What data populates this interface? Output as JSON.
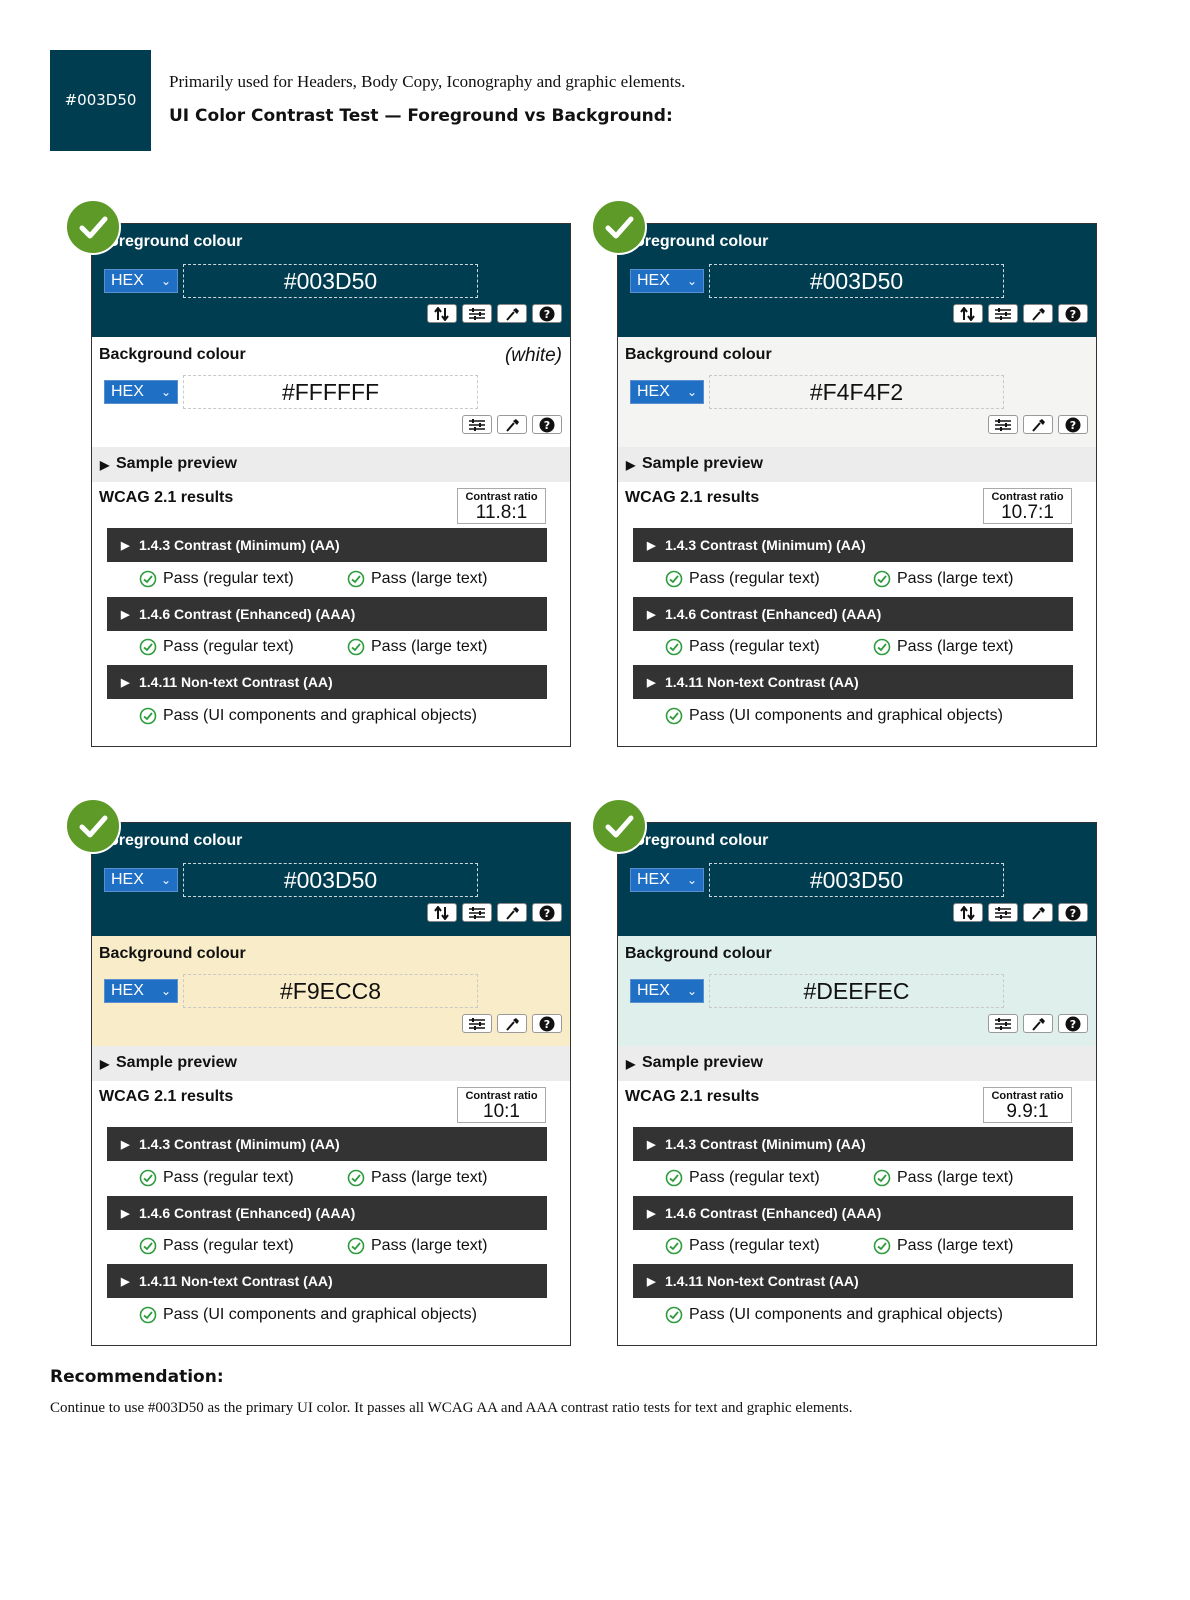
{
  "header": {
    "swatch_label": "#003D50",
    "swatch_color": "#003D50",
    "intro": "Primarily used for Headers, Body Copy, Iconography and graphic elements.",
    "subtitle": "UI Color Contrast Test — Foreground vs Background:"
  },
  "cards": [
    {
      "fg_title": "oreground colour",
      "fg_format": "HEX",
      "fg_hex": "#003D50",
      "bg_title": "Background colour",
      "bg_note": "(white)",
      "bg_format": "HEX",
      "bg_hex": "#FFFFFF",
      "bg_color": "#FFFFFF",
      "sample_label": "Sample preview",
      "results_title": "WCAG 2.1 results",
      "ratio_label": "Contrast ratio",
      "ratio_value": "11.8:1",
      "criteria": [
        {
          "label": "1.4.3 Contrast (Minimum) (AA)",
          "results": [
            "Pass (regular text)",
            "Pass (large text)"
          ]
        },
        {
          "label": "1.4.6 Contrast (Enhanced) (AAA)",
          "results": [
            "Pass (regular text)",
            "Pass (large text)"
          ]
        },
        {
          "label": "1.4.11 Non-text Contrast (AA)",
          "results": [
            "Pass (UI components and graphical objects)"
          ]
        }
      ]
    },
    {
      "fg_title": "oreground colour",
      "fg_format": "HEX",
      "fg_hex": "#003D50",
      "bg_title": "Background colour",
      "bg_note": "",
      "bg_format": "HEX",
      "bg_hex": "#F4F4F2",
      "bg_color": "#F4F4F2",
      "sample_label": "Sample preview",
      "results_title": "WCAG 2.1 results",
      "ratio_label": "Contrast ratio",
      "ratio_value": "10.7:1",
      "criteria": [
        {
          "label": "1.4.3 Contrast (Minimum) (AA)",
          "results": [
            "Pass (regular text)",
            "Pass (large text)"
          ]
        },
        {
          "label": "1.4.6 Contrast (Enhanced) (AAA)",
          "results": [
            "Pass (regular text)",
            "Pass (large text)"
          ]
        },
        {
          "label": "1.4.11 Non-text Contrast (AA)",
          "results": [
            "Pass (UI components and graphical objects)"
          ]
        }
      ]
    },
    {
      "fg_title": "oreground colour",
      "fg_format": "HEX",
      "fg_hex": "#003D50",
      "bg_title": "Background colour",
      "bg_note": "",
      "bg_format": "HEX",
      "bg_hex": "#F9ECC8",
      "bg_color": "#F9ECC8",
      "sample_label": "Sample preview",
      "results_title": "WCAG 2.1 results",
      "ratio_label": "Contrast ratio",
      "ratio_value": "10:1",
      "criteria": [
        {
          "label": "1.4.3 Contrast (Minimum) (AA)",
          "results": [
            "Pass (regular text)",
            "Pass (large text)"
          ]
        },
        {
          "label": "1.4.6 Contrast (Enhanced) (AAA)",
          "results": [
            "Pass (regular text)",
            "Pass (large text)"
          ]
        },
        {
          "label": "1.4.11 Non-text Contrast (AA)",
          "results": [
            "Pass (UI components and graphical objects)"
          ]
        }
      ]
    },
    {
      "fg_title": "oreground colour",
      "fg_format": "HEX",
      "fg_hex": "#003D50",
      "bg_title": "Background colour",
      "bg_note": "",
      "bg_format": "HEX",
      "bg_hex": "#DEEFEC",
      "bg_color": "#DEEFEC",
      "sample_label": "Sample preview",
      "results_title": "WCAG 2.1 results",
      "ratio_label": "Contrast ratio",
      "ratio_value": "9.9:1",
      "criteria": [
        {
          "label": "1.4.3 Contrast (Minimum) (AA)",
          "results": [
            "Pass (regular text)",
            "Pass (large text)"
          ]
        },
        {
          "label": "1.4.6 Contrast (Enhanced) (AAA)",
          "results": [
            "Pass (regular text)",
            "Pass (large text)"
          ]
        },
        {
          "label": "1.4.11 Non-text Contrast (AA)",
          "results": [
            "Pass (UI components and graphical objects)"
          ]
        }
      ]
    }
  ],
  "recommendation": {
    "title": "Recommendation:",
    "text": "Continue to use #003D50 as the primary UI color. It passes all WCAG AA and AAA contrast ratio tests for text and graphic elements."
  },
  "colors": {
    "brand": "#003D50",
    "pass_green": "#2E9B3E",
    "badge_green": "#5E9A28",
    "select_blue": "#1F6FC5",
    "criteria_bar": "#333333"
  },
  "icons": [
    "check-badge-icon",
    "swap-icon",
    "sliders-icon",
    "eyedropper-icon",
    "help-icon",
    "chevron-down-icon",
    "check-circle-icon",
    "triangle-right-icon"
  ]
}
